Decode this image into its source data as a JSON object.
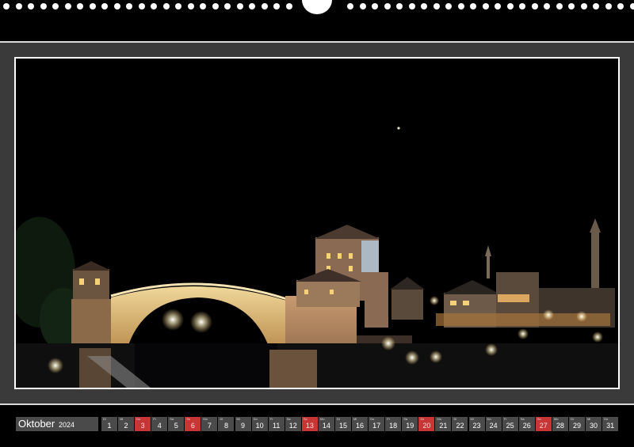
{
  "calendar": {
    "month": "Oktober",
    "year": "2024",
    "days": [
      {
        "num": "1",
        "abbr": "Di",
        "holiday": false
      },
      {
        "num": "2",
        "abbr": "Mi",
        "holiday": false
      },
      {
        "num": "3",
        "abbr": "Do",
        "holiday": true
      },
      {
        "num": "4",
        "abbr": "Fr",
        "holiday": false
      },
      {
        "num": "5",
        "abbr": "Sa",
        "holiday": false
      },
      {
        "num": "6",
        "abbr": "So",
        "holiday": true
      },
      {
        "num": "7",
        "abbr": "Mo",
        "holiday": false
      },
      {
        "num": "8",
        "abbr": "Di",
        "holiday": false
      },
      {
        "num": "9",
        "abbr": "Mi",
        "holiday": false
      },
      {
        "num": "10",
        "abbr": "Do",
        "holiday": false
      },
      {
        "num": "11",
        "abbr": "Fr",
        "holiday": false
      },
      {
        "num": "12",
        "abbr": "Sa",
        "holiday": false
      },
      {
        "num": "13",
        "abbr": "So",
        "holiday": true
      },
      {
        "num": "14",
        "abbr": "Mo",
        "holiday": false
      },
      {
        "num": "15",
        "abbr": "Di",
        "holiday": false
      },
      {
        "num": "16",
        "abbr": "Mi",
        "holiday": false
      },
      {
        "num": "17",
        "abbr": "Do",
        "holiday": false
      },
      {
        "num": "18",
        "abbr": "Fr",
        "holiday": false
      },
      {
        "num": "19",
        "abbr": "Sa",
        "holiday": false
      },
      {
        "num": "20",
        "abbr": "So",
        "holiday": true
      },
      {
        "num": "21",
        "abbr": "Mo",
        "holiday": false
      },
      {
        "num": "22",
        "abbr": "Di",
        "holiday": false
      },
      {
        "num": "23",
        "abbr": "Mi",
        "holiday": false
      },
      {
        "num": "24",
        "abbr": "Do",
        "holiday": false
      },
      {
        "num": "25",
        "abbr": "Fr",
        "holiday": false
      },
      {
        "num": "26",
        "abbr": "Sa",
        "holiday": false
      },
      {
        "num": "27",
        "abbr": "So",
        "holiday": true
      },
      {
        "num": "28",
        "abbr": "Mo",
        "holiday": false
      },
      {
        "num": "29",
        "abbr": "Di",
        "holiday": false
      },
      {
        "num": "30",
        "abbr": "Mi",
        "holiday": false
      },
      {
        "num": "31",
        "abbr": "Do",
        "holiday": false
      }
    ]
  },
  "colors": {
    "holiday": "#c73535",
    "cell": "#4a4a4a",
    "bridge_light": "#e8c88a"
  },
  "photo": {
    "subject": "night-scene-stone-arch-bridge-with-tower-and-lit-town"
  }
}
